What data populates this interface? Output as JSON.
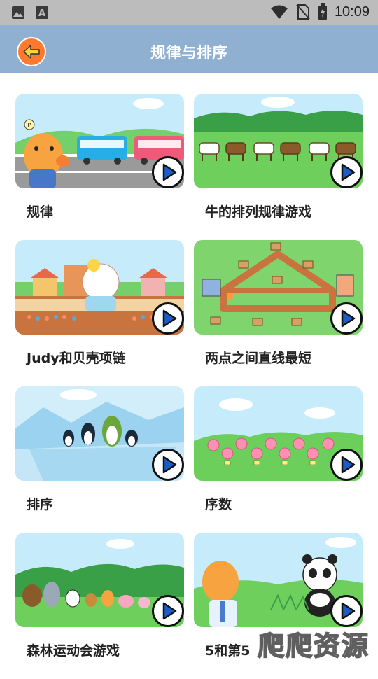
{
  "status_bar": {
    "time": "10:09",
    "icons": [
      "image-icon",
      "font-icon",
      "wifi-icon",
      "no-sim-icon",
      "battery-icon"
    ]
  },
  "header": {
    "title": "规律与排序",
    "back_icon": "back-arrow-icon"
  },
  "cards": [
    {
      "title": "规律",
      "scene": "buses"
    },
    {
      "title": "牛的排列规律游戏",
      "scene": "cows"
    },
    {
      "title": "Judy和贝壳项链",
      "scene": "shells"
    },
    {
      "title": "两点之间直线最短",
      "scene": "map"
    },
    {
      "title": "排序",
      "scene": "penguins"
    },
    {
      "title": "序数",
      "scene": "flowers"
    },
    {
      "title": "森林运动会游戏",
      "scene": "animals"
    },
    {
      "title": "5和第5",
      "scene": "panda"
    }
  ],
  "watermark": "爬爬资源",
  "colors": {
    "status_bar": "#bcbcbc",
    "title_bar": "#8fb0d1",
    "back_button": "#ff7a2e",
    "sky": "#bfe8fb",
    "grass": "#58c35a"
  }
}
